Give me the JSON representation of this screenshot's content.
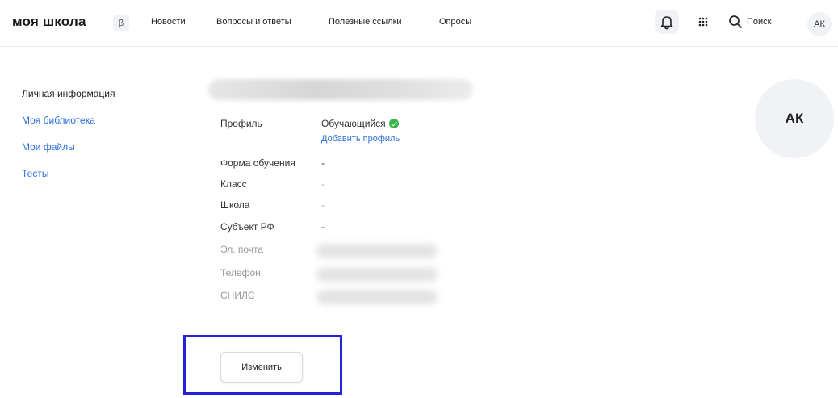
{
  "header": {
    "logo": "моя школа",
    "beta": "β",
    "nav": [
      "Новости",
      "Вопросы и ответы",
      "Полезные ссылки",
      "Опросы"
    ],
    "search_label": "Поиск",
    "avatar_initials": "АК",
    "icons": [
      "bell-icon",
      "apps-grid-icon",
      "search-icon"
    ]
  },
  "sidebar": {
    "items": [
      {
        "label": "Личная информация",
        "active": true
      },
      {
        "label": "Моя библиотека",
        "active": false
      },
      {
        "label": "Мои файлы",
        "active": false
      },
      {
        "label": "Тесты",
        "active": false
      }
    ]
  },
  "profile": {
    "profile_label": "Профиль",
    "profile_value": "Обучающийся",
    "add_profile": "Добавить профиль",
    "fields": [
      {
        "label": "Форма обучения",
        "value": "-"
      },
      {
        "label": "Класс",
        "value": "-"
      },
      {
        "label": "Школа",
        "value": "-"
      },
      {
        "label": "Субъект РФ",
        "value": "-"
      }
    ],
    "private_fields": [
      "Эл. почта",
      "Телефон",
      "СНИЛС"
    ],
    "avatar_initials": "АК",
    "edit_button": "Изменить"
  },
  "colors": {
    "link": "#2a6fdb",
    "check": "#3bb54a",
    "highlight": "#2424d6"
  }
}
